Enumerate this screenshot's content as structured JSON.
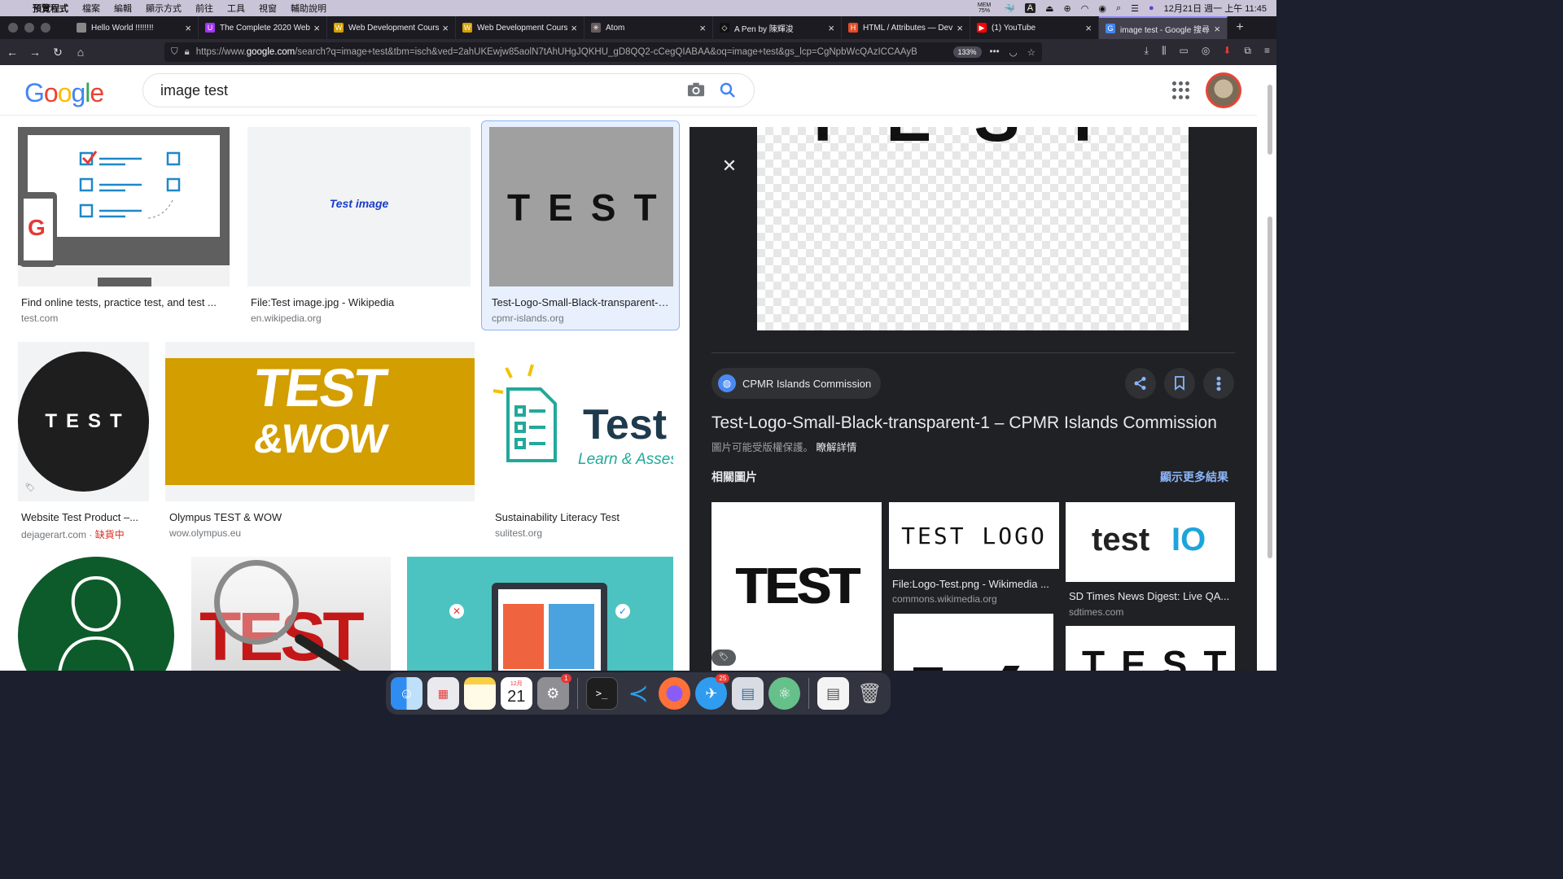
{
  "menubar": {
    "items": [
      "預覽程式",
      "檔案",
      "編輯",
      "顯示方式",
      "前往",
      "工具",
      "視窗",
      "輔助說明"
    ],
    "mem": "MEM 75%",
    "clock": "12月21日 週一 上午 11:45"
  },
  "tabs": [
    {
      "title": "Hello World !!!!!!!!",
      "fav": "",
      "color": "#888"
    },
    {
      "title": "The Complete 2020 Web",
      "fav": "U",
      "color": "#a435f0"
    },
    {
      "title": "Web Development Course",
      "fav": "W",
      "color": "#d6a100"
    },
    {
      "title": "Web Development Course",
      "fav": "W",
      "color": "#d6a100"
    },
    {
      "title": "Atom",
      "fav": "✳",
      "color": "#66595c"
    },
    {
      "title": "A Pen by 陳輝浚",
      "fav": "◇",
      "color": "#111"
    },
    {
      "title": "HTML / Attributes — Dev",
      "fav": "H",
      "color": "#e34c26"
    },
    {
      "title": "(1) YouTube",
      "fav": "▶",
      "color": "#ff0000"
    },
    {
      "title": "image test - Google 搜尋",
      "fav": "G",
      "color": "#4285f4"
    }
  ],
  "url": {
    "prefix": "https://www.",
    "host": "google.com",
    "rest": "/search?q=image+test&tbm=isch&ved=2ahUKEwjw85aolN7tAhUHgJQKHU_gD8QQ2-cCegQIABAA&oq=image+test&gs_lcp=CgNpbWcQAzICCAAyB",
    "zoom": "133%"
  },
  "search": {
    "query": "image test"
  },
  "results": [
    {
      "caption": "Find online tests, practice test, and test ...",
      "source": "test.com",
      "oos": ""
    },
    {
      "caption": "File:Test image.jpg - Wikipedia",
      "source": "en.wikipedia.org",
      "oos": "",
      "thumb_text": "Test image"
    },
    {
      "caption": "Test-Logo-Small-Black-transparent-1 ...",
      "source": "cpmr-islands.org",
      "oos": "",
      "thumb_text": "TEST"
    },
    {
      "caption": "Website Test Product –...",
      "source": "dejagerart.com · ",
      "oos": "缺貨中",
      "thumb_text": "TEST"
    },
    {
      "caption": "Olympus TEST & WOW",
      "source": "wow.olympus.eu",
      "oos": "",
      "thumb_text": "TEST",
      "thumb_text2": "&WOW"
    },
    {
      "caption": "Sustainability Literacy Test",
      "source": "sulitest.org",
      "oos": "",
      "thumb_text": "Test",
      "thumb_text2": "Learn & Asses"
    },
    {
      "caption": "",
      "source": "",
      "oos": ""
    },
    {
      "caption": "",
      "source": "",
      "oos": "",
      "thumb_text": "TEST"
    },
    {
      "caption": "",
      "source": "",
      "oos": ""
    }
  ],
  "panel": {
    "source_name": "CPMR Islands Commission",
    "title": "Test-Logo-Small-Black-transparent-1 – CPMR Islands Commission",
    "notice": "圖片可能受版權保護。",
    "learn_more": "瞭解詳情",
    "related_label": "相關圖片",
    "more_label": "顯示更多結果",
    "big_text": "TEST",
    "related": [
      {
        "caption": "",
        "source": "",
        "thumb_text": "TEST"
      },
      {
        "caption": "File:Logo-Test.png - Wikimedia ...",
        "source": "commons.wikimedia.org",
        "thumb_text": "TEST LOGO"
      },
      {
        "caption": "SD Times News Digest: Live QA...",
        "source": "sdtimes.com",
        "thumb_text": "test",
        "thumb_text2": "IO"
      },
      {
        "caption": "",
        "source": "",
        "thumb_text": ""
      },
      {
        "caption": "",
        "source": "",
        "thumb_text": "TEST"
      }
    ]
  },
  "dock": {
    "calendar_month": "12月",
    "calendar_day": "21",
    "settings_badge": "1",
    "app_badge": "25"
  }
}
